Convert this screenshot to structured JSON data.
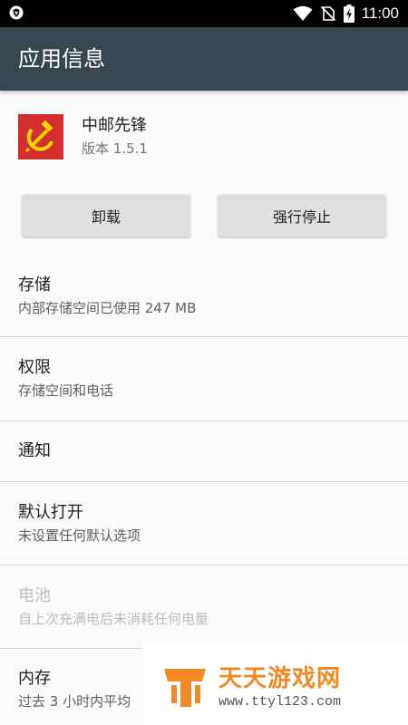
{
  "status_bar": {
    "time": "11:00",
    "icons": [
      "shield-notification-icon",
      "wifi-icon",
      "no-sim-icon",
      "battery-charging-icon"
    ]
  },
  "app_bar": {
    "title": "应用信息"
  },
  "app": {
    "name": "中邮先锋",
    "version": "版本 1.5.1",
    "icon": "hammer-sickle-icon"
  },
  "buttons": {
    "uninstall": "卸载",
    "force_stop": "强行停止"
  },
  "items": [
    {
      "title": "存储",
      "subtitle": "内部存储空间已使用 247 MB"
    },
    {
      "title": "权限",
      "subtitle": "存储空间和电话"
    },
    {
      "title": "通知"
    },
    {
      "title": "默认打开",
      "subtitle": "未设置任何默认选项"
    },
    {
      "title": "电池",
      "subtitle": "自上次充满电后未消耗任何电量",
      "disabled": true
    },
    {
      "title": "内存",
      "subtitle": "过去 3 小时内平均"
    }
  ],
  "watermark": {
    "title": "天天游戏网",
    "url": "www.ttyl123.com"
  },
  "colors": {
    "app_bar": "#37474f",
    "app_icon": "#d32f2f",
    "watermark": "#f08a24"
  }
}
